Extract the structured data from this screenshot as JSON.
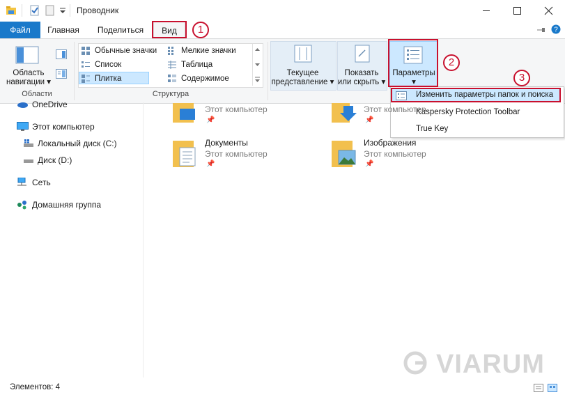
{
  "window": {
    "title": "Проводник",
    "controls": {
      "minimize": "minimize",
      "maximize": "maximize",
      "close": "close"
    }
  },
  "ribbon": {
    "tabs": [
      "Файл",
      "Главная",
      "Поделиться",
      "Вид"
    ],
    "active_tab": "Вид",
    "groups": {
      "panes": {
        "label": "Области",
        "nav_pane_button": [
          "Область",
          "навигации"
        ]
      },
      "layout": {
        "label": "Структура",
        "items": [
          "Обычные значки",
          "Мелкие значки",
          "Список",
          "Таблица",
          "Плитка",
          "Содержимое"
        ],
        "selected": "Плитка"
      },
      "current_view": {
        "label": [
          "Текущее",
          "представление"
        ]
      },
      "show_hide": {
        "label": [
          "Показать",
          "или скрыть"
        ]
      },
      "options": {
        "label": "Параметры"
      }
    }
  },
  "options_menu": {
    "items": [
      "Изменить параметры папок и поиска",
      "Kaspersky Protection Toolbar",
      "True Key"
    ]
  },
  "nav_pane": {
    "items": [
      "OneDrive",
      "Этот компьютер",
      "Локальный диск (C:)",
      "Диск (D:)",
      "Сеть",
      "Домашняя группа"
    ]
  },
  "content": {
    "tiles": [
      {
        "name": "",
        "location": "Этот компьютер"
      },
      {
        "name": "",
        "location": "Этот компьютер"
      },
      {
        "name": "Документы",
        "location": "Этот компьютер"
      },
      {
        "name": "Изображения",
        "location": "Этот компьютер"
      }
    ]
  },
  "status": {
    "items_count": "Элементов: 4"
  },
  "annotations": {
    "step1": "1",
    "step2": "2",
    "step3": "3"
  },
  "watermark": "VIARUM",
  "colors": {
    "file_tab": "#1979ca",
    "annotation": "#c8102e",
    "selection": "#cce8ff"
  }
}
